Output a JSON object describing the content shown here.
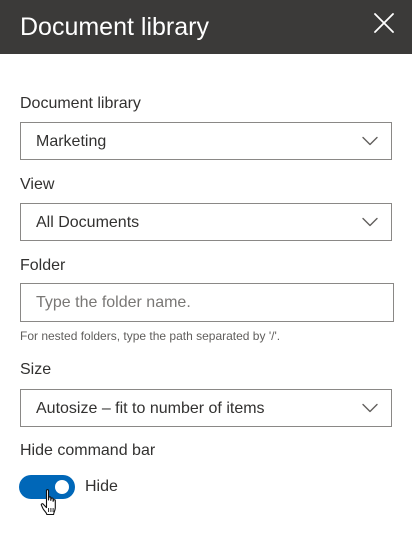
{
  "panel": {
    "title": "Document library",
    "close_icon": "close-icon"
  },
  "fields": {
    "document_library": {
      "label": "Document library",
      "value": "Marketing",
      "icon": "chevron-down-icon"
    },
    "view": {
      "label": "View",
      "value": "All Documents",
      "icon": "chevron-down-icon"
    },
    "folder": {
      "label": "Folder",
      "value": "",
      "placeholder": "Type the folder name.",
      "helper": "For nested folders, type the path separated by '/'."
    },
    "size": {
      "label": "Size",
      "value": "Autosize – fit to number of items",
      "icon": "chevron-down-icon"
    },
    "hide_command_bar": {
      "label": "Hide command bar",
      "toggle_label": "Hide",
      "checked": true
    }
  },
  "colors": {
    "header_bg": "#3b3a39",
    "toggle_on": "#0067b8",
    "border": "#8a8886"
  },
  "cursor_icon": "hand-pointer-icon"
}
